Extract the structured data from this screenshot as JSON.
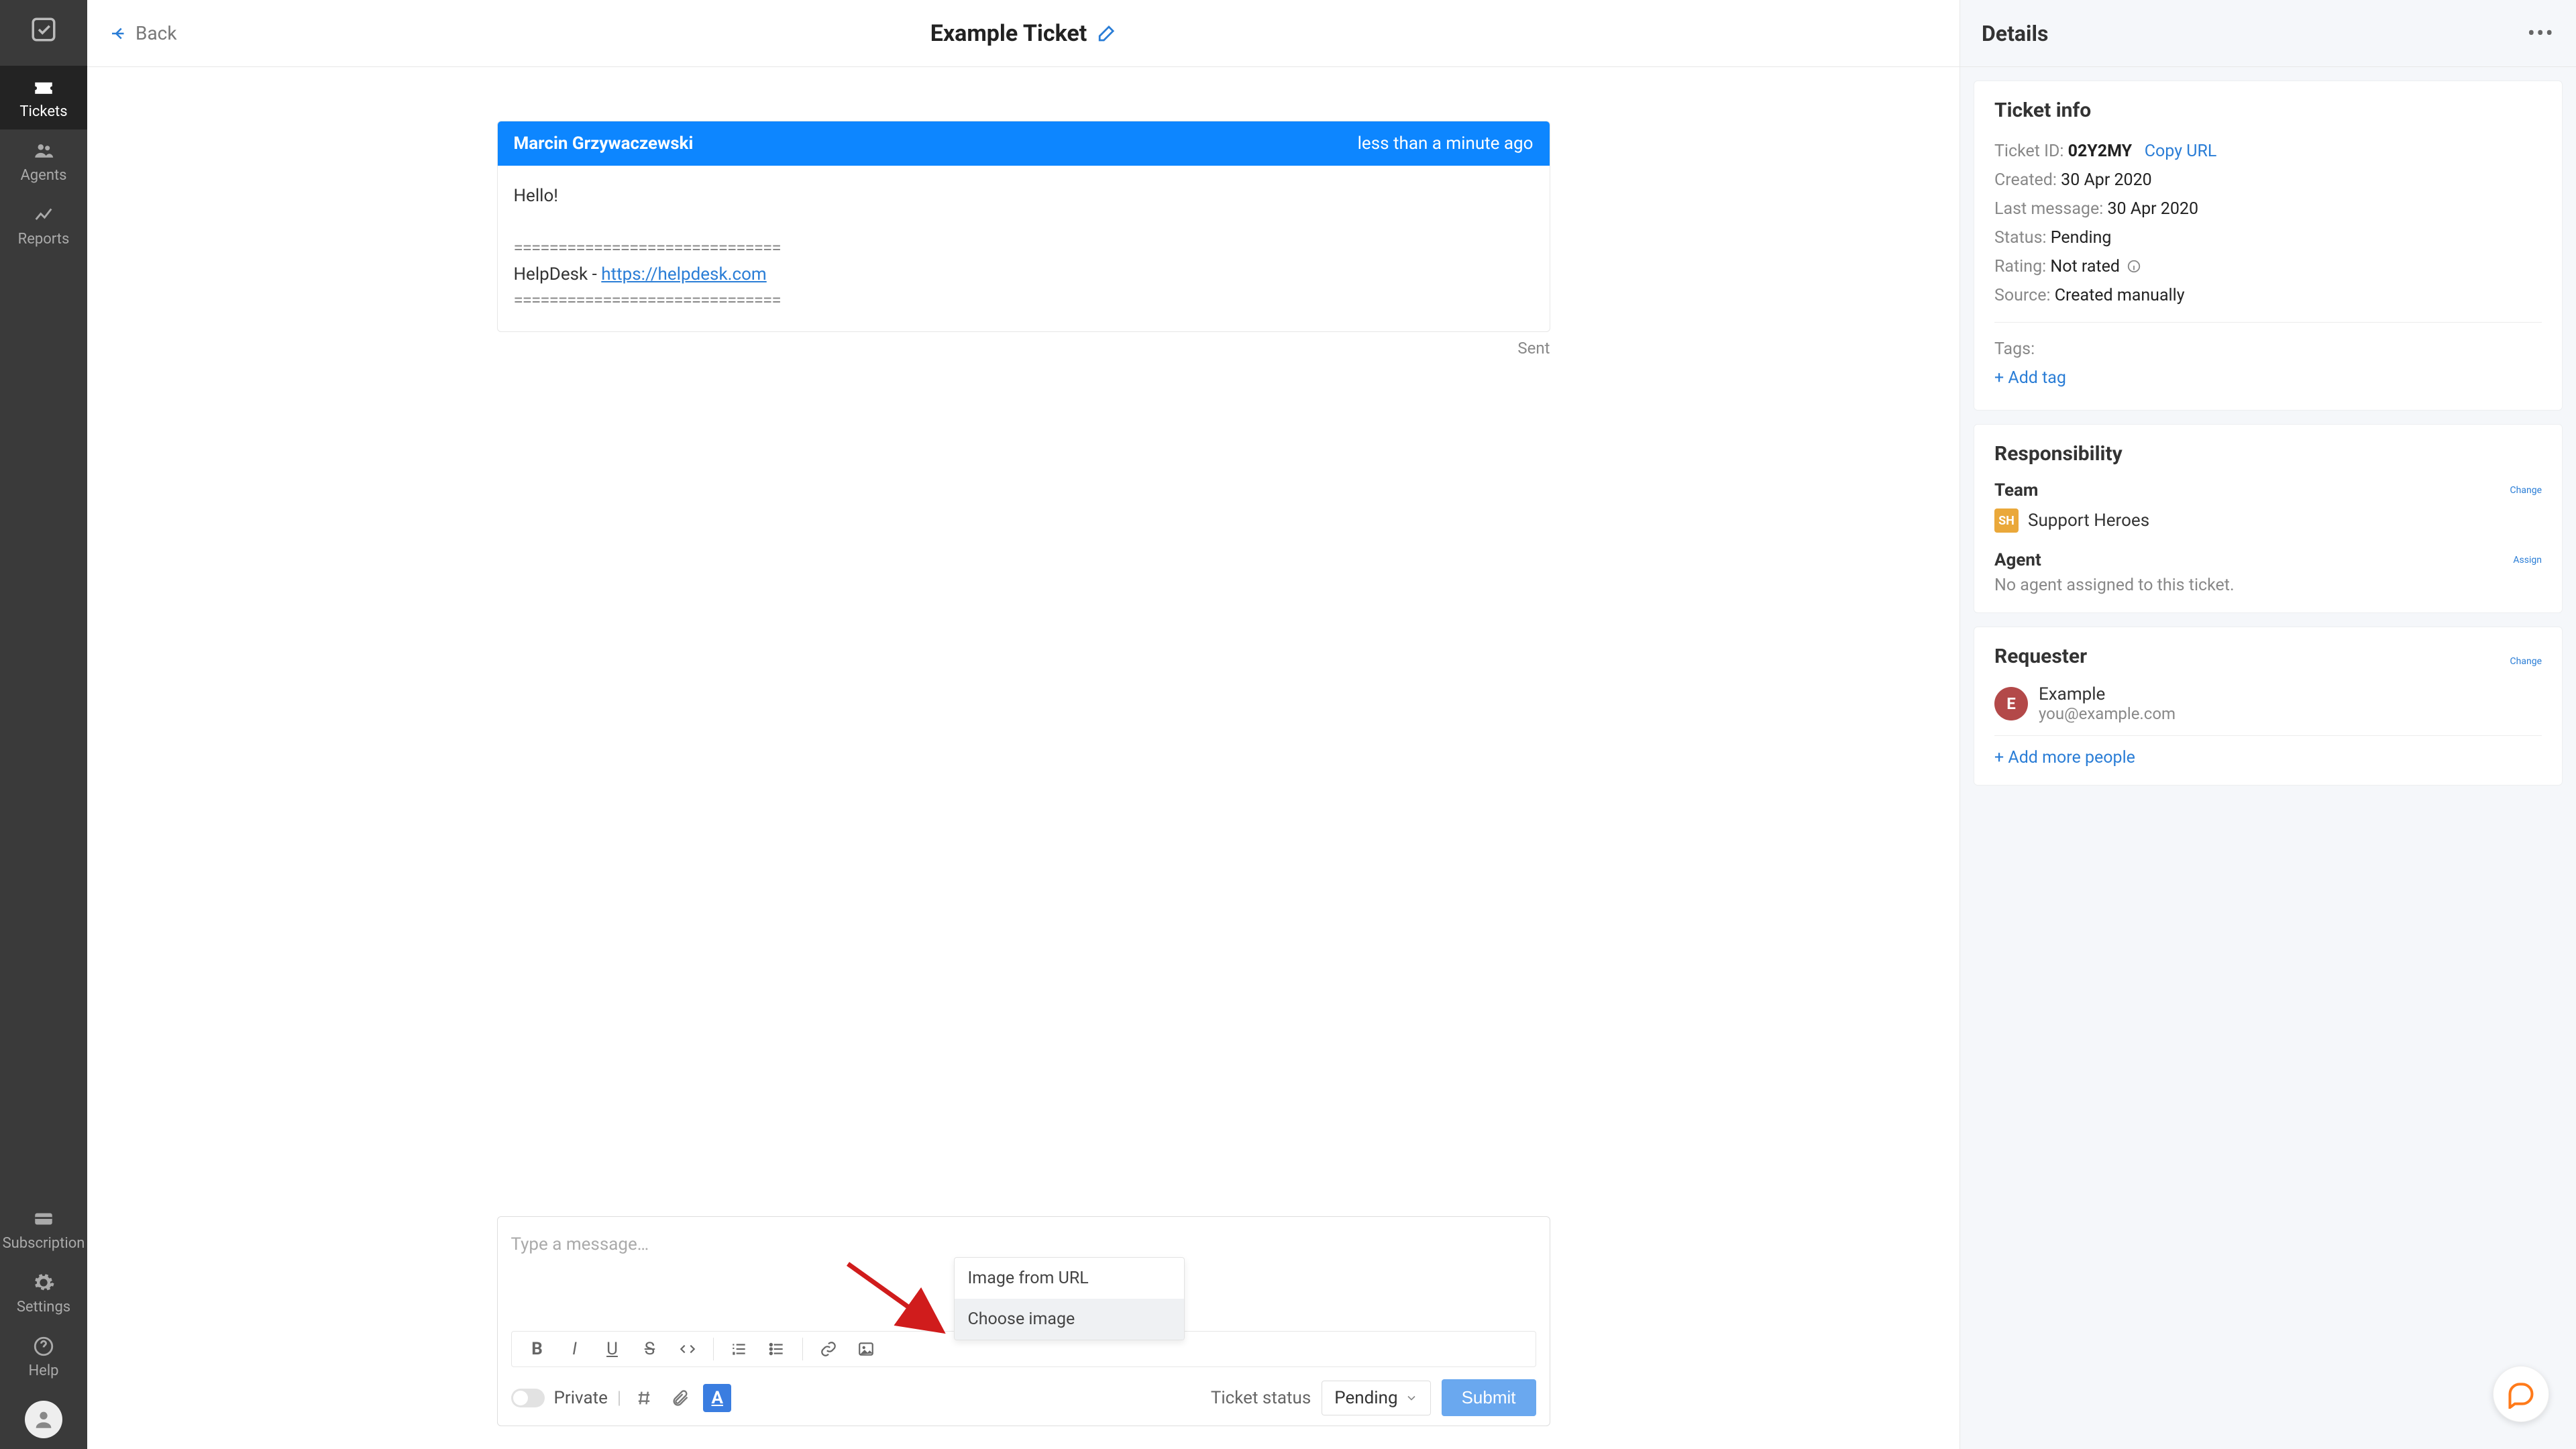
{
  "sidebar": {
    "items": [
      {
        "label": "Tickets"
      },
      {
        "label": "Agents"
      },
      {
        "label": "Reports"
      }
    ],
    "bottom_items": [
      {
        "label": "Subscription"
      },
      {
        "label": "Settings"
      },
      {
        "label": "Help"
      }
    ]
  },
  "topbar": {
    "back_label": "Back",
    "title": "Example Ticket"
  },
  "message": {
    "author": "Marcin Grzywaczewski",
    "time": "less than a minute ago",
    "body_greeting": "Hello!",
    "separator": "==============================",
    "signature_prefix": "HelpDesk - ",
    "signature_url": "https://helpdesk.com",
    "status": "Sent"
  },
  "composer": {
    "placeholder": "Type a message…",
    "private_label": "Private",
    "status_label": "Ticket status",
    "status_value": "Pending",
    "submit_label": "Submit",
    "image_popup": {
      "opt_url": "Image from URL",
      "opt_choose": "Choose image"
    }
  },
  "details": {
    "header": "Details",
    "ticket_info": {
      "title": "Ticket info",
      "ticket_id_label": "Ticket ID:",
      "ticket_id": "02Y2MY",
      "copy_url": "Copy URL",
      "created_label": "Created:",
      "created": "30 Apr 2020",
      "last_msg_label": "Last message:",
      "last_msg": "30 Apr 2020",
      "status_label": "Status:",
      "status": "Pending",
      "rating_label": "Rating:",
      "rating": "Not rated",
      "source_label": "Source:",
      "source": "Created manually",
      "tags_label": "Tags:",
      "add_tag": "+ Add tag"
    },
    "responsibility": {
      "title": "Responsibility",
      "team_label": "Team",
      "change": "Change",
      "team_badge": "SH",
      "team_name": "Support Heroes",
      "agent_label": "Agent",
      "assign": "Assign",
      "agent_none": "No agent assigned to this ticket."
    },
    "requester": {
      "title": "Requester",
      "change": "Change",
      "avatar_letter": "E",
      "name": "Example",
      "email": "you@example.com",
      "add_more": "+ Add more people"
    }
  }
}
